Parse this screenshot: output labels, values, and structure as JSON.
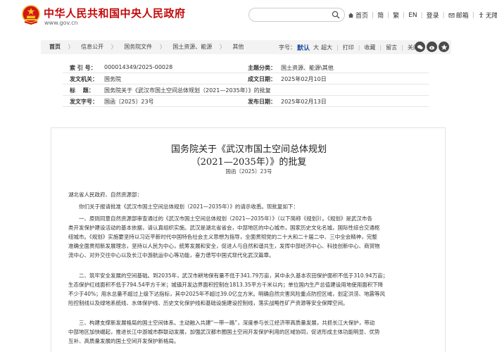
{
  "header": {
    "site_title": "中华人民共和国中央人民政府",
    "site_url": "www.gov.cn",
    "search_placeholder": "",
    "links": [
      {
        "label": "首页",
        "icon": "home-icon"
      },
      {
        "label": "简",
        "icon": ""
      },
      {
        "label": "繁",
        "icon": ""
      },
      {
        "label": "EN",
        "icon": ""
      },
      {
        "label": "登录",
        "icon": ""
      },
      {
        "label": "邮箱",
        "icon": "mail-icon"
      },
      {
        "label": "无障碍",
        "icon": "accessibility-icon"
      }
    ]
  },
  "breadcrumb": {
    "items": [
      "首页",
      "信息公开",
      "国务院文件",
      "国土资源、能源",
      "其他"
    ]
  },
  "toolbar": {
    "font_label": "字号：",
    "font_default": "默认",
    "font_big": "大",
    "font_huge": "超大",
    "print": "打印",
    "favorite": "收藏",
    "leave": "留言",
    "close": "关闭"
  },
  "share_icons": [
    "wechat-icon",
    "weibo-icon",
    "qq-zone-icon"
  ],
  "info": {
    "rows": [
      {
        "l1": "索 引 号：",
        "v1": "000014349/2025-00028",
        "l2": "主题分类：",
        "v2": "国土资源、能源\\其他"
      },
      {
        "l1": "发文机关：",
        "v1": "国务院",
        "l2": "成文日期：",
        "v2": "2025年02月10日"
      },
      {
        "l1": "标　 题：",
        "v1": "国务院关于《武汉市国土空间总体规划（2021—2035年）》的批复",
        "l2": "",
        "v2": ""
      },
      {
        "l1": "发文字号：",
        "v1": "国函〔2025〕23号",
        "l2": "发布日期：",
        "v2": "2025年02月13日"
      }
    ]
  },
  "article": {
    "title_line1": "国务院关于《武汉市国土空间总体规划",
    "title_line2": "（2021—2035年）》的批复",
    "doc_number": "国函〔2025〕23号",
    "salutation": "湖北省人民政府、自然资源部：",
    "p1": [
      "你们关于报请批准《武汉市国土空间总体规划（2021—2035年）》的请示收悉。现批复如下："
    ],
    "p2": [
      "一、原则同意自然资源部审查通过的《武汉市国土空间总体规划（2021—2035年）》（以下简称《规划》）。《规划》是武汉市各",
      "类开发保护建设活动的基本依据，请认真组织实施。武汉是湖北省省会，中部地区的中心城市，国家历史文化名城，国际性综合交通枢",
      "纽城市。《规划》实施要坚持以习近平新时代中国特色社会主义思想为指导，全面贯彻党的二十大和二十届二中、三中全会精神，完整",
      "准确全面贯彻新发展理念，坚持以人民为中心，统筹发展和安全，促进人与自然和谐共生，发挥中部经济中心、科技创新中心、商贸物",
      "流中心、对外交往中心以及长江中游航运中心等功能，奋力谱写中国式现代化武汉篇章。"
    ],
    "p3": [
      "二、筑牢安全发展的空间基础。到2035年，武汉市耕地保有量不低于341.79万亩，其中永久基本农田保护面积不低于310.94万亩；",
      "生态保护红线面积不低于794.54平方千米；城镇开发边界面积控制在1813.35平方千米以内；单位国内生产总值建设用地使用面积下降",
      "不少于40%；用水总量不超过上级下达指标，其中2025年不超过39.0亿立方米。明确自然灾害风险重点防控区域，划定洪涝、地震等风",
      "险控制线以及绿地系统线、水体保护线、历史文化保护线和基础设施建设控制线，落实战略性矿产资源等安全保障空间。"
    ],
    "p4": [
      "三、构建支撑新发展格局的国土空间体系。主动融入共建“一带一路”，深度参与长江经济带高质量发展，共抓长江大保护，带动",
      "中部地区加快崛起，推进长江中游城市群联动发展，加强武汉都市圈国土空间开发保护利用的区域协同，促进形成主体功能明显、优势",
      "互补、高质量发展的国土空间开发保护新格局。"
    ]
  }
}
